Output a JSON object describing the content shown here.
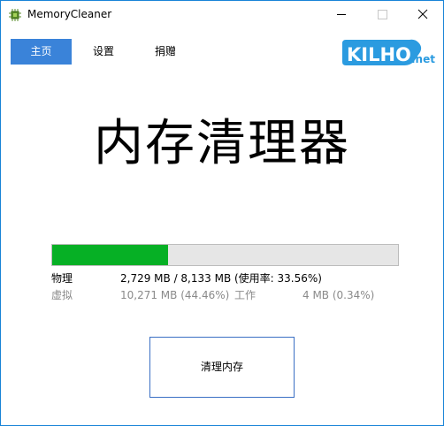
{
  "window": {
    "title": "MemoryCleaner",
    "accent_color": "#1883d7"
  },
  "titlebar": {
    "minimize_icon": "minimize-icon",
    "maximize_icon": "maximize-icon",
    "close_icon": "close-icon"
  },
  "nav": {
    "items": [
      {
        "label": "主页",
        "active": true
      },
      {
        "label": "设置",
        "active": false
      },
      {
        "label": "捐赠",
        "active": false
      }
    ],
    "active_color": "#3a83d9"
  },
  "logo": {
    "text": "KILHO",
    "suffix": ".net",
    "color": "#2b9be0"
  },
  "main": {
    "title": "内存清理器"
  },
  "memory": {
    "usage_fraction": 0.3356,
    "bar_color": "#06b025",
    "physical": {
      "label": "物理",
      "value": "2,729 MB / 8,133 MB (使用率: 33.56%)"
    },
    "virtual": {
      "label": "虚拟",
      "value": "10,271 MB (44.46%)"
    },
    "working": {
      "label": "工作",
      "value": "4 MB (0.34%)"
    }
  },
  "actions": {
    "clean_label": "清理内存"
  }
}
